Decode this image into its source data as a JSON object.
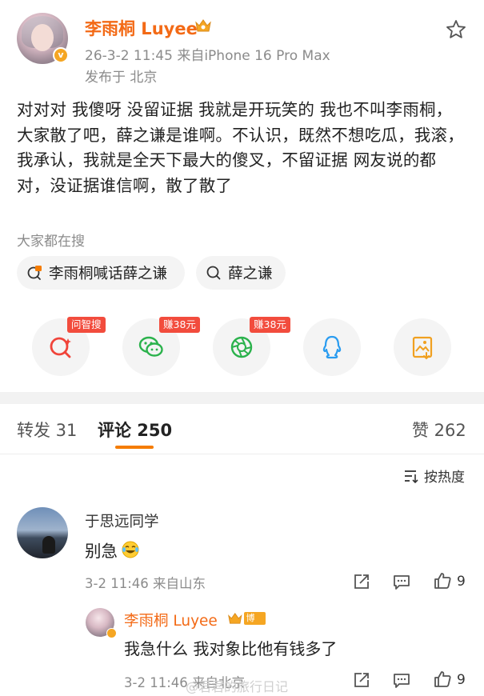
{
  "post": {
    "author": "李雨桐 Luyee",
    "meta": "26-3-2 11:45 来自iPhone 16 Pro Max",
    "location": "发布于 北京",
    "body": "对对对 我傻呀 没留证据 我就是开玩笑的 我也不叫李雨桐，大家散了吧，薛之谦是谁啊。不认识，既然不想吃瓜，我滚，我承认，我就是全天下最大的傻叉，不留证据 网友说的都对，没证据谁信啊，散了散了"
  },
  "hot_search": {
    "title": "大家都在搜",
    "chips": [
      "李雨桐喊话薛之谦",
      "薛之谦"
    ]
  },
  "share": {
    "tags": [
      "问智搜",
      "赚38元",
      "赚38元"
    ],
    "icons": [
      "ai-search-icon",
      "wechat-icon",
      "moments-icon",
      "qq-icon",
      "save-image-icon"
    ]
  },
  "tabs": {
    "repost": "转发 31",
    "comment": "评论 250",
    "like": "赞 262"
  },
  "sort": {
    "label": "按热度"
  },
  "comment": {
    "name": "于思远同学",
    "text": "别急",
    "meta": "3-2 11:46 来自山东",
    "likes": "9"
  },
  "reply": {
    "name": "李雨桐 Luyee",
    "tag": "博主",
    "text": "我急什么 我对象比他有钱多了",
    "meta": "3-2 11:46 来自北京",
    "likes": "9"
  },
  "watermark": "@君君的旅行日记",
  "colors": {
    "brand_orange": "#f36a16",
    "tag_red": "#f24c3d",
    "underline": "#f57c00"
  }
}
